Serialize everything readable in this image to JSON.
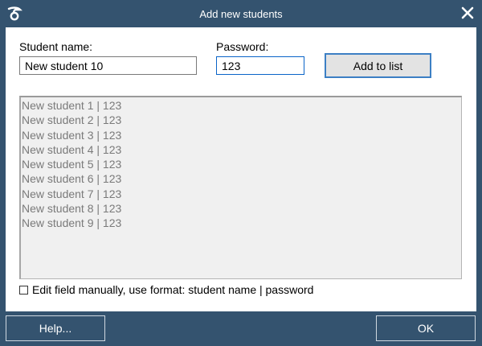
{
  "window": {
    "title": "Add new students",
    "app_icon": "app-logo-icon",
    "close_icon": "close-icon"
  },
  "form": {
    "student_name_label": "Student name:",
    "student_name_value": "New student 10",
    "password_label": "Password:",
    "password_value": "123",
    "add_button_label": "Add to list"
  },
  "student_list": [
    "New student 1 | 123",
    "New student 2 | 123",
    "New student 3 | 123",
    "New student 4 | 123",
    "New student 5 | 123",
    "New student 6 | 123",
    "New student 7 | 123",
    "New student 8 | 123",
    "New student 9 | 123"
  ],
  "manual_edit": {
    "checked": false,
    "label": "Edit field manually, use format: student name | password"
  },
  "footer": {
    "help_label": "Help...",
    "ok_label": "OK"
  },
  "colors": {
    "frame": "#34536f",
    "button_focus_border": "#3c7fc4",
    "list_background": "#f0f0f0",
    "list_text": "#7a7a7a"
  }
}
